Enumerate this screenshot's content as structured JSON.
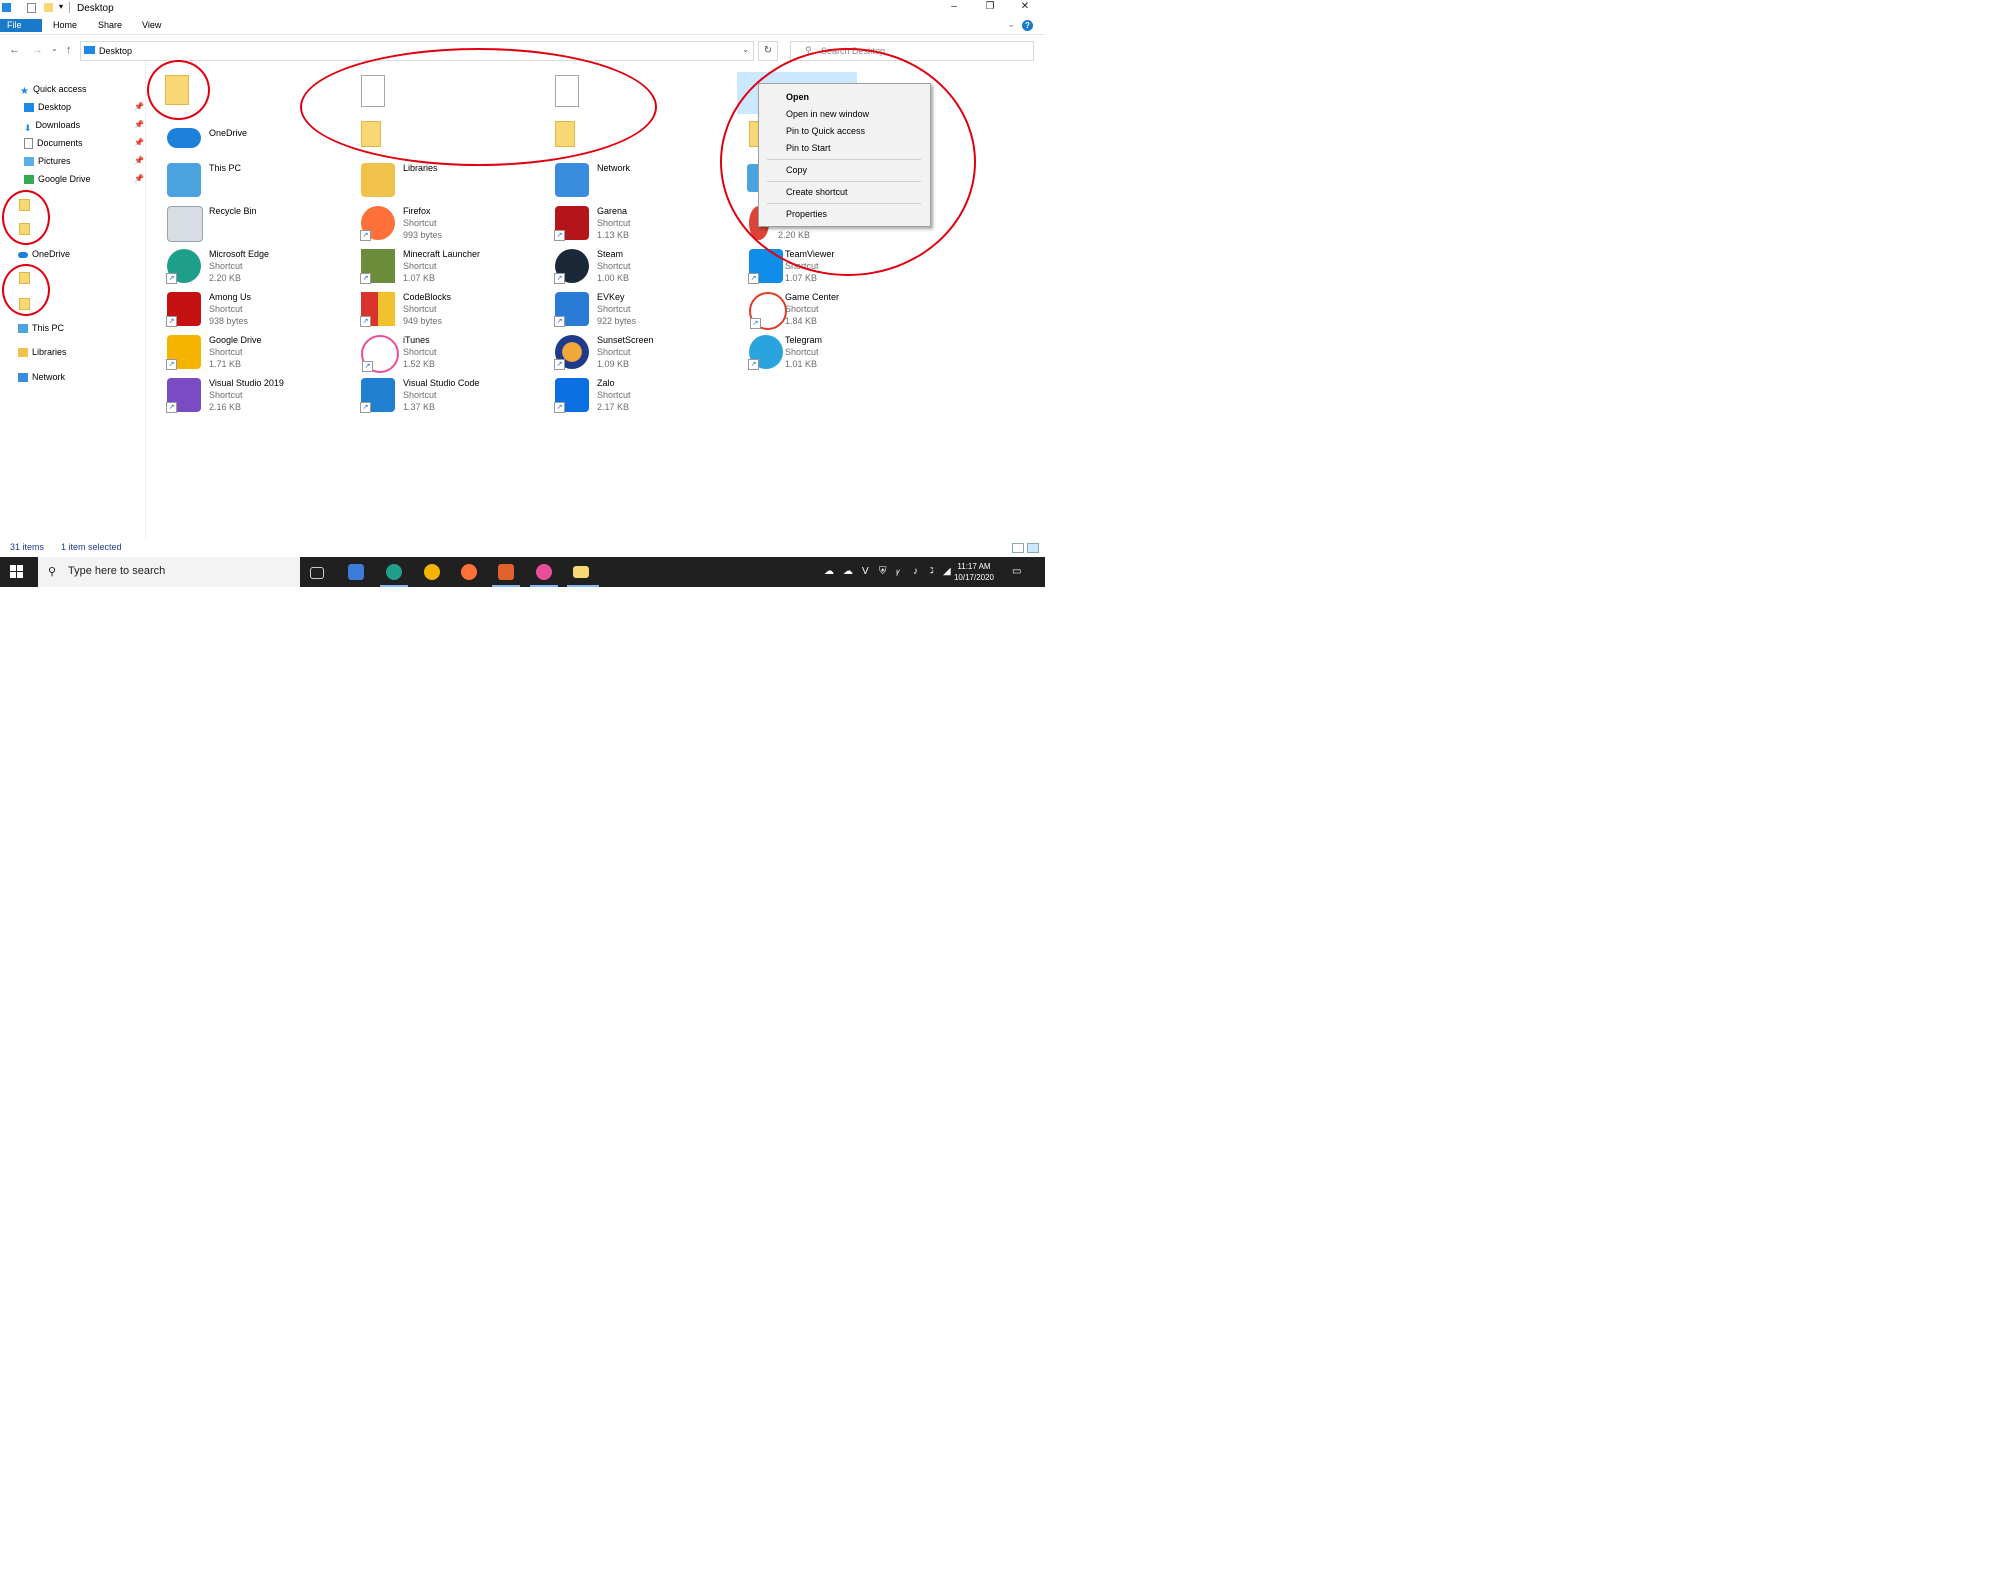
{
  "window": {
    "title": "Desktop"
  },
  "ribbon": {
    "tabs": [
      "File",
      "Home",
      "Share",
      "View"
    ],
    "help": "?"
  },
  "address": {
    "path": "Desktop",
    "search_placeholder": "Search Desktop"
  },
  "nav": {
    "quick_access": "Quick access",
    "pinned": [
      "Desktop",
      "Downloads",
      "Documents",
      "Pictures",
      "Google Drive"
    ],
    "onedrive": "OneDrive",
    "this_pc": "This PC",
    "libraries": "Libraries",
    "network": "Network"
  },
  "items": [
    {
      "name": "OneDrive",
      "type": "",
      "size": "",
      "color": "#1e7fd8"
    },
    {
      "name": "Libraries",
      "type": "",
      "size": "",
      "color": "#f1c24b"
    },
    {
      "name": "Network",
      "type": "",
      "size": "",
      "color": "#3a8dde"
    },
    {
      "name": "This PC",
      "type": "",
      "size": "",
      "color": "#4aa3df"
    },
    {
      "name": "Firefox",
      "type": "Shortcut",
      "size": "993 bytes",
      "color": "#ff7139"
    },
    {
      "name": "Garena",
      "type": "Shortcut",
      "size": "1.13 KB",
      "color": "#b3151b"
    },
    {
      "name": "2.20 KB",
      "type": "",
      "size": "",
      "color": "#db4437"
    },
    {
      "name": "Recycle Bin",
      "type": "",
      "size": "",
      "color": "#8fa6b3"
    },
    {
      "name": "Minecraft Launcher",
      "type": "Shortcut",
      "size": "1.07 KB",
      "color": "#6b8c3a"
    },
    {
      "name": "Steam",
      "type": "Shortcut",
      "size": "1.00 KB",
      "color": "#1b2838"
    },
    {
      "name": "TeamViewer",
      "type": "Shortcut",
      "size": "1.07 KB",
      "color": "#0e8ee9"
    },
    {
      "name": "Microsoft Edge",
      "type": "Shortcut",
      "size": "2.20 KB",
      "color": "#1f9f8a"
    },
    {
      "name": "CodeBlocks",
      "type": "Shortcut",
      "size": "949 bytes",
      "color": "#d9342b"
    },
    {
      "name": "EVKey",
      "type": "Shortcut",
      "size": "922 bytes",
      "color": "#2a7bd5"
    },
    {
      "name": "Game Center",
      "type": "Shortcut",
      "size": "1.84 KB",
      "color": "#e23b2e"
    },
    {
      "name": "Among Us",
      "type": "Shortcut",
      "size": "938 bytes",
      "color": "#c51111"
    },
    {
      "name": "iTunes",
      "type": "Shortcut",
      "size": "1.52 KB",
      "color": "#e84f9a"
    },
    {
      "name": "SunsetScreen",
      "type": "Shortcut",
      "size": "1.09 KB",
      "color": "#f0a83a"
    },
    {
      "name": "Telegram",
      "type": "Shortcut",
      "size": "1.01 KB",
      "color": "#2aa3df"
    },
    {
      "name": "Google Drive",
      "type": "Shortcut",
      "size": "1.71 KB",
      "color": "#f4b400"
    },
    {
      "name": "Visual Studio Code",
      "type": "Shortcut",
      "size": "1.37 KB",
      "color": "#1f7fd1"
    },
    {
      "name": "Zalo",
      "type": "Shortcut",
      "size": "2.17 KB",
      "color": "#0a6fe0"
    },
    {
      "name": "Visual Studio 2019",
      "type": "Shortcut",
      "size": "2.16 KB",
      "color": "#7b4bc4"
    }
  ],
  "context_menu": [
    "Open",
    "Open in new window",
    "Pin to Quick access",
    "Pin to Start",
    "Copy",
    "Create shortcut",
    "Properties"
  ],
  "status": {
    "count": "31 items",
    "selected": "1 item selected"
  },
  "taskbar": {
    "search_placeholder": "Type here to search",
    "time": "11:17 AM",
    "date": "10/17/2020"
  }
}
